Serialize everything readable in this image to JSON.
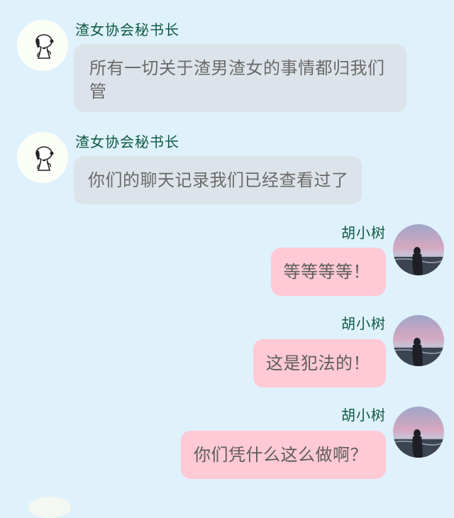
{
  "messages": [
    {
      "side": "left",
      "sender": "渣女协会秘书长",
      "avatar_icon": "snoopy-avatar",
      "text": "所有一切关于渣男渣女的事情都归我们管"
    },
    {
      "side": "left",
      "sender": "渣女协会秘书长",
      "avatar_icon": "snoopy-avatar",
      "text": "你们的聊天记录我们已经查看过了"
    },
    {
      "side": "right",
      "sender": "胡小树",
      "avatar_icon": "beach-sunset-avatar",
      "text": "等等等等！"
    },
    {
      "side": "right",
      "sender": "胡小树",
      "avatar_icon": "beach-sunset-avatar",
      "text": "这是犯法的！"
    },
    {
      "side": "right",
      "sender": "胡小树",
      "avatar_icon": "beach-sunset-avatar",
      "text": "你们凭什么这么做啊？"
    }
  ],
  "colors": {
    "background": "#dff1fb",
    "left_bubble": "#dde3ea",
    "right_bubble": "#ffc9d6",
    "sender_name": "#0f5a43"
  }
}
